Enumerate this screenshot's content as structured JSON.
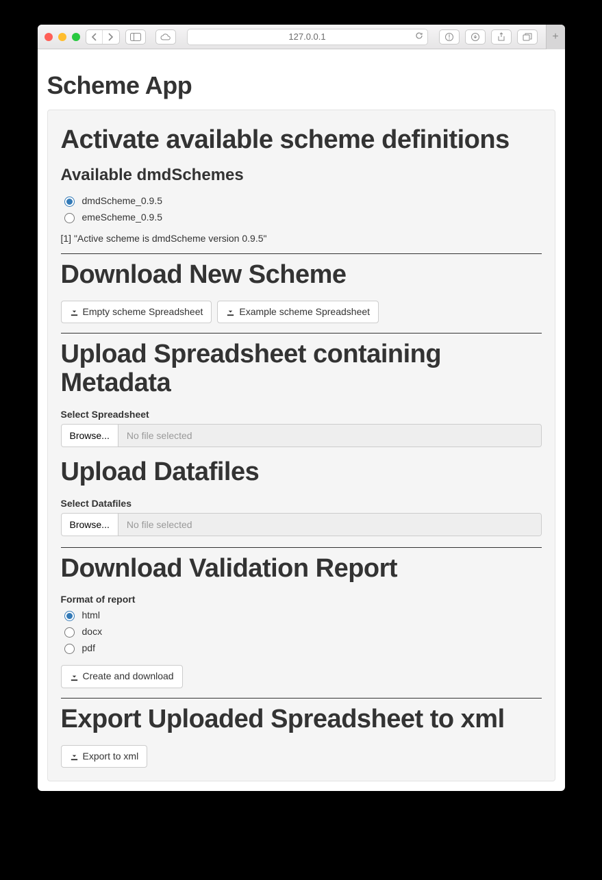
{
  "browser": {
    "url": "127.0.0.1"
  },
  "app": {
    "title": "Scheme App"
  },
  "activate": {
    "heading": "Activate available scheme definitions",
    "subheading": "Available dmdSchemes",
    "options": [
      {
        "label": "dmdScheme_0.9.5",
        "selected": true
      },
      {
        "label": "emeScheme_0.9.5",
        "selected": false
      }
    ],
    "status": "[1] \"Active scheme is dmdScheme version 0.9.5\""
  },
  "download_scheme": {
    "heading": "Download New Scheme",
    "empty_btn": "Empty scheme Spreadsheet",
    "example_btn": "Example scheme Spreadsheet"
  },
  "upload_spreadsheet": {
    "heading": "Upload Spreadsheet containing Metadata",
    "label": "Select Spreadsheet",
    "browse": "Browse...",
    "placeholder": "No file selected"
  },
  "upload_datafiles": {
    "heading": "Upload Datafiles",
    "label": "Select Datafiles",
    "browse": "Browse...",
    "placeholder": "No file selected"
  },
  "validation": {
    "heading": "Download Validation Report",
    "label": "Format of report",
    "options": [
      {
        "label": "html",
        "selected": true
      },
      {
        "label": "docx",
        "selected": false
      },
      {
        "label": "pdf",
        "selected": false
      }
    ],
    "create_btn": "Create and download"
  },
  "export": {
    "heading": "Export Uploaded Spreadsheet to xml",
    "btn": "Export to xml"
  }
}
